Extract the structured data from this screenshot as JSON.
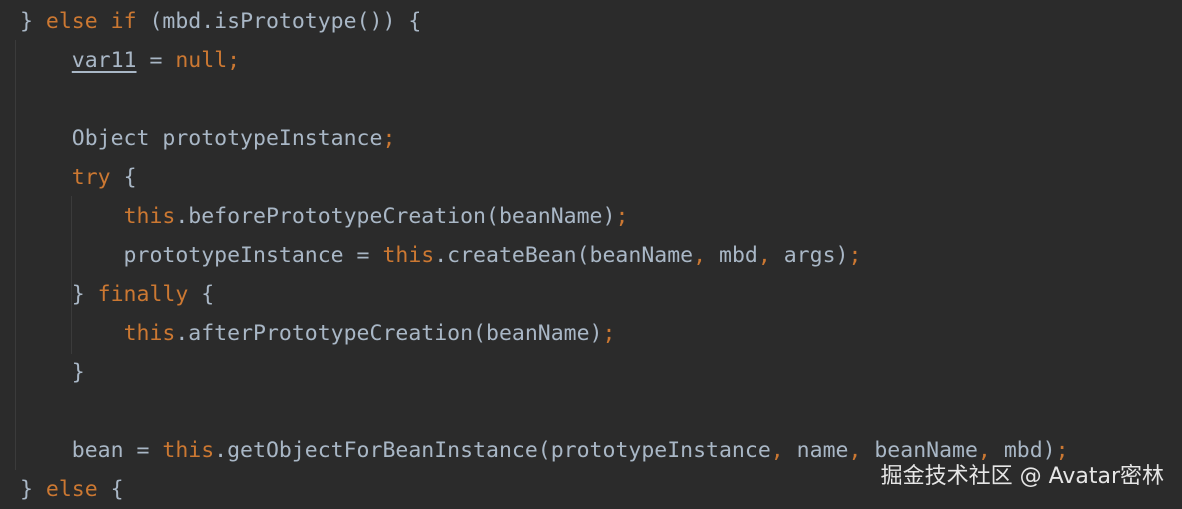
{
  "code": {
    "lines": [
      {
        "tokens": [
          {
            "t": "} ",
            "c": "pl"
          },
          {
            "t": "else",
            "c": "kw"
          },
          {
            "t": " ",
            "c": "pl"
          },
          {
            "t": "if",
            "c": "kw"
          },
          {
            "t": " (mbd.isPrototype()) {",
            "c": "pl"
          }
        ]
      },
      {
        "tokens": [
          {
            "t": "    ",
            "c": "pl"
          },
          {
            "t": "var11",
            "c": "var"
          },
          {
            "t": " = ",
            "c": "pl"
          },
          {
            "t": "null",
            "c": "kw"
          },
          {
            "t": ";",
            "c": "kw"
          }
        ]
      },
      {
        "tokens": []
      },
      {
        "tokens": [
          {
            "t": "    Object prototypeInstance",
            "c": "pl"
          },
          {
            "t": ";",
            "c": "kw"
          }
        ]
      },
      {
        "tokens": [
          {
            "t": "    ",
            "c": "pl"
          },
          {
            "t": "try",
            "c": "kw"
          },
          {
            "t": " {",
            "c": "pl"
          }
        ]
      },
      {
        "tokens": [
          {
            "t": "        ",
            "c": "pl"
          },
          {
            "t": "this",
            "c": "kw"
          },
          {
            "t": ".beforePrototypeCreation(beanName)",
            "c": "pl"
          },
          {
            "t": ";",
            "c": "kw"
          }
        ]
      },
      {
        "tokens": [
          {
            "t": "        prototypeInstance = ",
            "c": "pl"
          },
          {
            "t": "this",
            "c": "kw"
          },
          {
            "t": ".createBean(beanName",
            "c": "pl"
          },
          {
            "t": ",",
            "c": "kw"
          },
          {
            "t": " mbd",
            "c": "pl"
          },
          {
            "t": ",",
            "c": "kw"
          },
          {
            "t": " args)",
            "c": "pl"
          },
          {
            "t": ";",
            "c": "kw"
          }
        ]
      },
      {
        "tokens": [
          {
            "t": "    } ",
            "c": "pl"
          },
          {
            "t": "finally",
            "c": "kw"
          },
          {
            "t": " {",
            "c": "pl"
          }
        ]
      },
      {
        "tokens": [
          {
            "t": "        ",
            "c": "pl"
          },
          {
            "t": "this",
            "c": "kw"
          },
          {
            "t": ".afterPrototypeCreation(beanName)",
            "c": "pl"
          },
          {
            "t": ";",
            "c": "kw"
          }
        ]
      },
      {
        "tokens": [
          {
            "t": "    }",
            "c": "pl"
          }
        ]
      },
      {
        "tokens": []
      },
      {
        "tokens": [
          {
            "t": "    bean = ",
            "c": "pl"
          },
          {
            "t": "this",
            "c": "kw"
          },
          {
            "t": ".getObjectForBeanInstance(prototypeInstance",
            "c": "pl"
          },
          {
            "t": ",",
            "c": "kw"
          },
          {
            "t": " name",
            "c": "pl"
          },
          {
            "t": ",",
            "c": "kw"
          },
          {
            "t": " beanName",
            "c": "pl"
          },
          {
            "t": ",",
            "c": "kw"
          },
          {
            "t": " mbd)",
            "c": "pl"
          },
          {
            "t": ";",
            "c": "kw"
          }
        ]
      },
      {
        "tokens": [
          {
            "t": "} ",
            "c": "pl"
          },
          {
            "t": "else",
            "c": "kw"
          },
          {
            "t": " {",
            "c": "pl"
          }
        ]
      }
    ]
  },
  "watermark": {
    "text": "掘金技术社区 @ Avatar密林"
  },
  "colors": {
    "background": "#2b2b2b",
    "keyword": "#cc7832",
    "text": "#a9b7c6",
    "indent_guide": "#3b3b3b"
  }
}
